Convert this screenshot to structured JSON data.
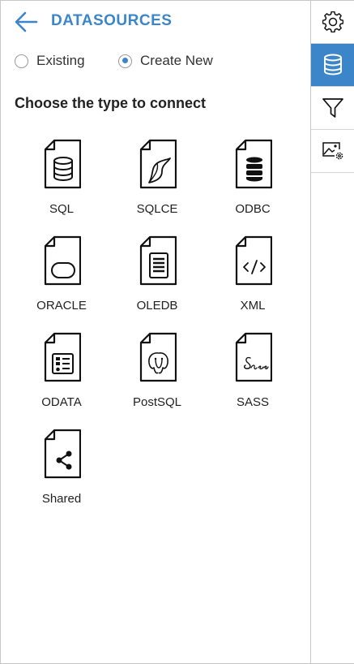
{
  "header": {
    "title": "DATASOURCES"
  },
  "mode": {
    "existing_label": "Existing",
    "create_label": "Create New",
    "selected": "create_new"
  },
  "heading": "Choose the type to connect",
  "tiles": [
    {
      "label": "SQL",
      "icon": "database-icon"
    },
    {
      "label": "SQLCE",
      "icon": "sqlce-icon"
    },
    {
      "label": "ODBC",
      "icon": "database-filled-icon"
    },
    {
      "label": "ORACLE",
      "icon": "oracle-icon"
    },
    {
      "label": "OLEDB",
      "icon": "oledb-icon"
    },
    {
      "label": "XML",
      "icon": "code-icon"
    },
    {
      "label": "ODATA",
      "icon": "odata-icon"
    },
    {
      "label": "PostSQL",
      "icon": "postgresql-elephant-icon"
    },
    {
      "label": "SASS",
      "icon": "sass-icon"
    },
    {
      "label": "Shared",
      "icon": "share-icon"
    }
  ],
  "rail": [
    {
      "name": "settings",
      "icon": "gear-icon",
      "active": false
    },
    {
      "name": "datasources",
      "icon": "database-icon",
      "active": true
    },
    {
      "name": "filter",
      "icon": "filter-icon",
      "active": false
    },
    {
      "name": "image-settings",
      "icon": "image-settings-icon",
      "active": false
    }
  ],
  "colors": {
    "accent": "#3c85c8",
    "border": "#c8c8c8",
    "text": "#222222"
  }
}
